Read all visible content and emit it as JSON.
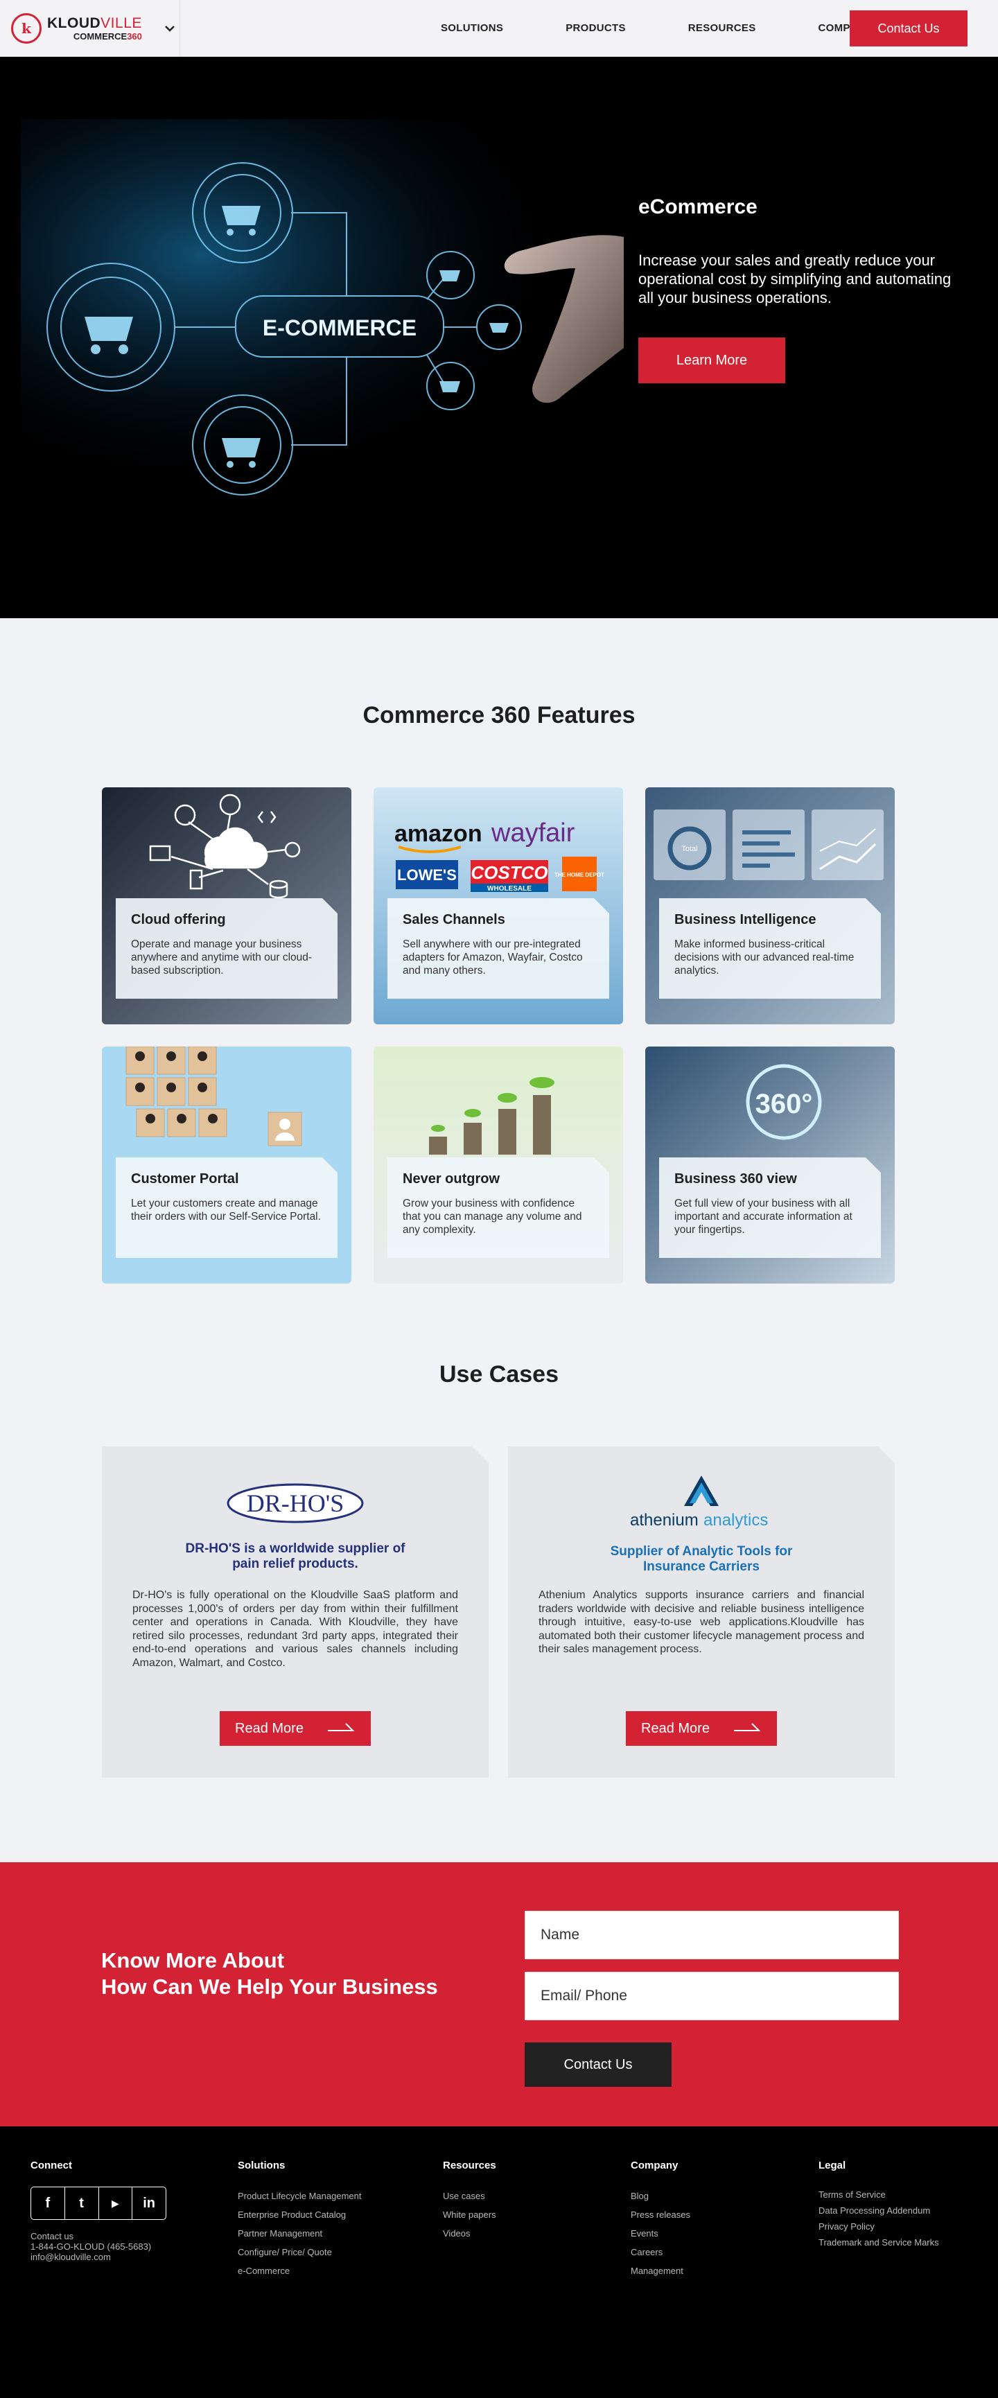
{
  "nav": {
    "brand_name_a": "KLOUD",
    "brand_name_b": "VILLE",
    "brand_sub_a": "COMMERCE",
    "brand_sub_b": "360",
    "brand_mark": "k",
    "menu_icon": "chevron-down-icon",
    "links": [
      "SOLUTIONS",
      "PRODUCTS",
      "RESOURCES",
      "COMPANY"
    ],
    "cta": "Contact Us"
  },
  "hero": {
    "title": "eCommerce",
    "description": "Increase your sales and greatly reduce your operational cost by simplifying and automating all your business operations.",
    "button": "Learn More",
    "art_label": "E-COMMERCE"
  },
  "features": {
    "title": "Commerce 360 Features",
    "cards": [
      {
        "title": "Cloud offering",
        "desc": "Operate and manage your business anywhere and anytime with our cloud-based subscription."
      },
      {
        "title": "Sales Channels",
        "desc": "Sell anywhere with our pre-integrated adapters for Amazon, Wayfair, Costco and many others."
      },
      {
        "title": "Business Intelligence",
        "desc": "Make informed business-critical decisions with our advanced real-time analytics."
      },
      {
        "title": "Customer Portal",
        "desc": "Let your customers create and manage their orders with our Self-Service Portal."
      },
      {
        "title": "Never outgrow",
        "desc": "Grow your business with confidence that you can manage any volume and any complexity."
      },
      {
        "title": "Business 360 view",
        "desc": "Get full view of your business with all important and accurate information at your fingertips."
      }
    ],
    "image_text": {
      "amazon": "amazon",
      "wayfair": "wayfair",
      "lowes": "LOWE'S",
      "costco": "COSTCO",
      "costco_sub": "WHOLESALE",
      "homedepot": "THE HOME DEPOT",
      "bi_widget": "Total",
      "view360": "360°"
    }
  },
  "use_cases": {
    "title": "Use Cases",
    "cards": [
      {
        "logo": "DR-HO'S",
        "headline": "DR-HO'S is a worldwide supplier of pain relief products.",
        "body": "Dr-HO's is fully operational on the Kloudville SaaS platform and processes 1,000's of orders per day from within their fulfillment center and operations in Canada. With Kloudville, they have retired silo processes, redundant 3rd party apps, integrated their end-to-end operations and various sales channels including Amazon, Walmart, and Costco.",
        "button": "Read More"
      },
      {
        "logo_a": "athenium",
        "logo_b": "analytics",
        "headline": "Supplier of Analytic Tools for Insurance Carriers",
        "body": "Athenium Analytics supports insurance carriers and financial traders worldwide with decisive and reliable business intelligence through intuitive, easy-to-use web applications.Kloudville has automated both their customer lifecycle management process and their sales management process.",
        "button": "Read More"
      }
    ],
    "colors": {
      "drho_headline": "#24307a",
      "athenium_headline": "#1a6fb5"
    }
  },
  "contact_band": {
    "title_line1": "Know More About",
    "title_line2": "How Can We Help Your Business",
    "name_placeholder": "Name",
    "email_placeholder": "Email/ Phone",
    "button": "Contact Us"
  },
  "footer": {
    "connect": {
      "heading": "Connect",
      "social_icons": [
        "facebook-icon",
        "twitter-icon",
        "youtube-icon",
        "linkedin-icon"
      ],
      "social_glyphs": [
        "f",
        "t",
        "▶",
        "in"
      ],
      "contact_label": "Contact us",
      "phone": "1-844-GO-KLOUD (465-5683)",
      "email": "info@kloudville.com"
    },
    "solutions": {
      "heading": "Solutions",
      "links": [
        "Product Lifecycle Management",
        "Enterprise Product Catalog",
        "Partner Management",
        "Configure/ Price/ Quote",
        "e-Commerce"
      ]
    },
    "resources": {
      "heading": "Resources",
      "links": [
        "Use cases",
        "White papers",
        "Videos"
      ]
    },
    "company": {
      "heading": "Company",
      "links": [
        "Blog",
        "Press releases",
        "Events",
        "Careers",
        "Management"
      ]
    },
    "legal": {
      "heading": "Legal",
      "links": [
        "Terms of Service",
        "Data Processing Addendum",
        "Privacy Policy",
        "Trademark and Service Marks"
      ]
    }
  },
  "theme": {
    "accent": "#d42235",
    "dark": "#000000",
    "page_bg": "#f1f2f6"
  }
}
